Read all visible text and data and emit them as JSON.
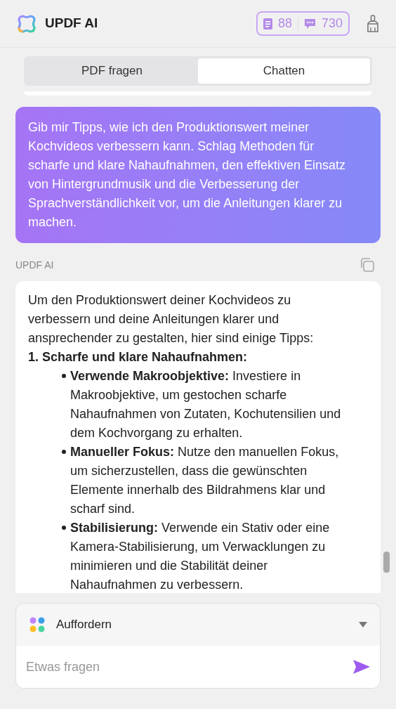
{
  "header": {
    "title": "UPDF AI",
    "counters": [
      "88",
      "730"
    ]
  },
  "tabs": [
    {
      "label": "PDF fragen",
      "selected": false
    },
    {
      "label": "Chatten",
      "selected": true
    }
  ],
  "user_message": "Gib mir Tipps, wie ich den Produktionswert meiner Kochvideos verbessern kann. Schlag Methoden für scharfe und klare Nahaufnahmen, den effektiven Einsatz von Hintergrundmusik und die Verbesserung der Sprachverständlichkeit vor, um die Anleitungen klarer zu machen.",
  "reply_label": "UPDF AI",
  "answer": {
    "intro": "Um den Produktionswert deiner Kochvideos zu verbessern und deine Anleitungen klarer und ansprechender zu gestalten, hier sind einige Tipps:",
    "sections": [
      {
        "heading": "1. Scharfe und klare Nahaufnahmen:",
        "bullets": [
          {
            "term": "Verwende Makroobjektive:",
            "text": " Investiere in Makroobjektive, um gestochen scharfe Nahaufnahmen von Zutaten, Kochutensilien und dem Kochvorgang zu erhalten."
          },
          {
            "term": "Manueller Fokus:",
            "text": " Nutze den manuellen Fokus, um sicherzustellen, dass die gewünschten Elemente innerhalb des Bildrahmens klar und scharf sind."
          },
          {
            "term": "Stabilisierung:",
            "text": " Verwende ein Stativ oder eine Kamera-Stabilisierung, um Verwacklungen zu minimieren und die Stabilität deiner Nahaufnahmen zu verbessern."
          }
        ]
      }
    ]
  },
  "composer": {
    "prompt_label": "Auffordern",
    "placeholder": "Etwas fragen"
  }
}
